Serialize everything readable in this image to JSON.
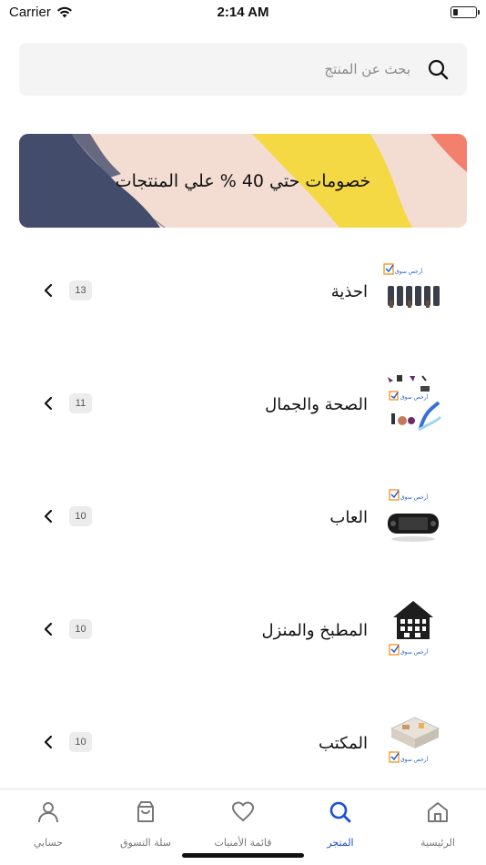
{
  "status_bar": {
    "carrier": "Carrier",
    "time": "2:14 AM",
    "battery_level": 0.25
  },
  "search": {
    "placeholder": "بحث عن المنتج",
    "value": ""
  },
  "banner": {
    "text": "خصومات حتي 40 % علي المنتجات",
    "colors": {
      "background": "#f3dcd2",
      "navy": "#444c6b",
      "yellow": "#f4d944",
      "coral": "#f2806d"
    }
  },
  "categories": [
    {
      "name": "احذية",
      "count": "13",
      "thumbnail": "shoes"
    },
    {
      "name": "الصحة والجمال",
      "count": "11",
      "thumbnail": "beauty"
    },
    {
      "name": "العاب",
      "count": "10",
      "thumbnail": "games"
    },
    {
      "name": "المطبخ والمنزل",
      "count": "10",
      "thumbnail": "kitchen-home"
    },
    {
      "name": "المكتب",
      "count": "10",
      "thumbnail": "office"
    }
  ],
  "tab_bar": {
    "active_color": "#1b4fd8",
    "tabs": [
      {
        "label": "الرئيسية",
        "icon": "home-icon"
      },
      {
        "label": "المتجر",
        "icon": "search-icon",
        "active": true
      },
      {
        "label": "قائمة الأمنيات",
        "icon": "heart-icon"
      },
      {
        "label": "سلة التسوق",
        "icon": "shopping-bag-icon"
      },
      {
        "label": "حسابي",
        "icon": "user-icon"
      }
    ]
  }
}
